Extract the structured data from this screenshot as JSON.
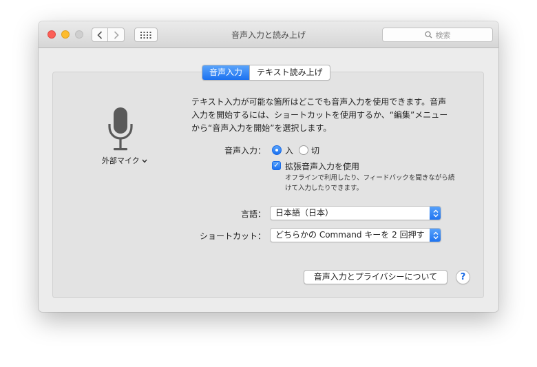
{
  "window": {
    "title": "音声入力と読み上げ",
    "search_placeholder": "検索"
  },
  "tabs": [
    {
      "label": "音声入力",
      "active": true
    },
    {
      "label": "テキスト読み上げ",
      "active": false
    }
  ],
  "mic": {
    "source_label": "外部マイク"
  },
  "description": "テキスト入力が可能な箇所はどこでも音声入力を使用できます。音声入力を開始するには、ショートカットを使用するか、“編集”メニューから“音声入力を開始”を選択します。",
  "dictation": {
    "label": "音声入力：",
    "on_label": "入",
    "off_label": "切",
    "selected": "入"
  },
  "enhanced": {
    "label": "拡張音声入力を使用",
    "checked": true,
    "hint": "オフラインで利用したり、フィードバックを聞きながら続けて入力したりできます。"
  },
  "language": {
    "label": "言語：",
    "value": "日本語（日本）"
  },
  "shortcut": {
    "label": "ショートカット：",
    "value": "どちらかの Command キーを 2 回押す"
  },
  "buttons": {
    "privacy": "音声入力とプライバシーについて",
    "help": "?"
  },
  "colors": {
    "accent": "#1b71f0"
  }
}
